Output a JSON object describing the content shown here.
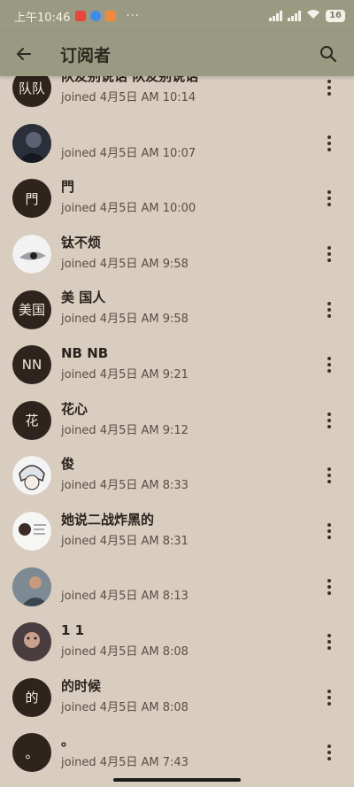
{
  "status_bar": {
    "time": "上午10:46",
    "dots": "···",
    "battery": "16"
  },
  "app_bar": {
    "title": "订阅者"
  },
  "subscribers": [
    {
      "avatar_text": "队队",
      "name": "队友别说话 队友别说话",
      "joined": "joined 4月5日 AM 10:14"
    },
    {
      "avatar_text": "",
      "name": "",
      "joined": "joined 4月5日 AM 10:07"
    },
    {
      "avatar_text": "門",
      "name": "門",
      "joined": "joined 4月5日 AM 10:00"
    },
    {
      "avatar_text": "",
      "name": "钛不烦",
      "joined": "joined 4月5日 AM 9:58"
    },
    {
      "avatar_text": "美国",
      "name": "美 国人",
      "joined": "joined 4月5日 AM 9:58"
    },
    {
      "avatar_text": "NN",
      "name": "NB NB",
      "joined": "joined 4月5日 AM 9:21"
    },
    {
      "avatar_text": "花",
      "name": "花心",
      "joined": "joined 4月5日 AM 9:12"
    },
    {
      "avatar_text": "",
      "name": "俊",
      "joined": "joined 4月5日 AM 8:33"
    },
    {
      "avatar_text": "",
      "name": "她说二战炸黑的",
      "joined": "joined 4月5日 AM 8:31"
    },
    {
      "avatar_text": "",
      "name": "",
      "joined": "joined 4月5日 AM 8:13"
    },
    {
      "avatar_text": "",
      "name": "1 1",
      "joined": "joined 4月5日 AM 8:08"
    },
    {
      "avatar_text": "的",
      "name": "的时候",
      "joined": "joined 4月5日 AM 8:08"
    },
    {
      "avatar_text": "。",
      "name": "。",
      "joined": "joined 4月5日 AM 7:43"
    }
  ],
  "colors": {
    "app_bar": "#9a9a82",
    "background": "#d9cdbf",
    "avatar": "#2e241d"
  }
}
